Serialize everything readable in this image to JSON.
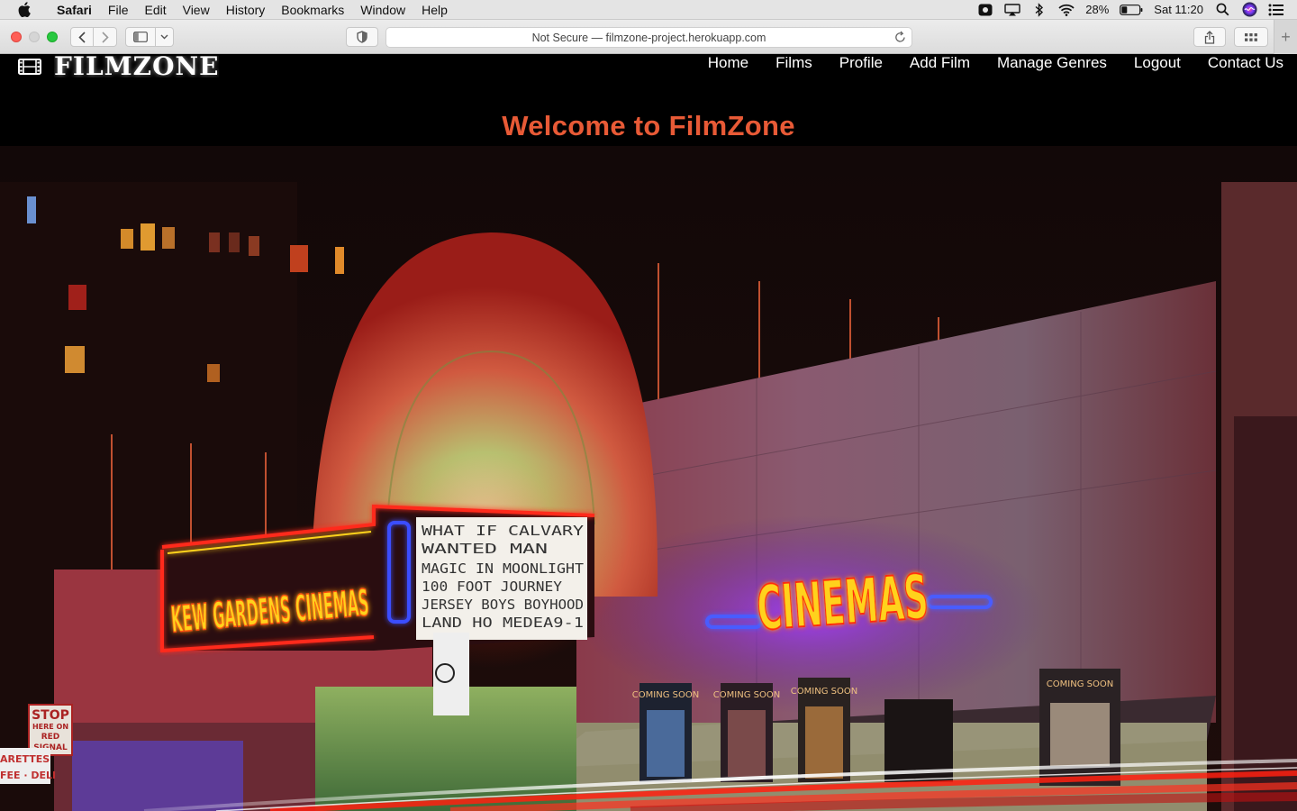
{
  "menubar": {
    "apple_icon": "apple-icon",
    "app_name": "Safari",
    "menus": [
      "File",
      "Edit",
      "View",
      "History",
      "Bookmarks",
      "Window",
      "Help"
    ],
    "battery": "28%",
    "clock": "Sat 11:20"
  },
  "browser": {
    "address": "Not Secure — filmzone-project.herokuapp.com"
  },
  "site": {
    "logo_text": "FILMZONE",
    "nav": [
      "Home",
      "Films",
      "Profile",
      "Add Film",
      "Manage Genres",
      "Logout",
      "Contact Us"
    ],
    "welcome": "Welcome to FilmZone",
    "hero_signs": {
      "marquee_left": "KEW GARDENS CINEMAS",
      "marquee_right": "CINEMAS",
      "board_lines": [
        "WHAT IF      CALVARY",
        "WANTED MAN",
        "MAGIC IN MOONLIGHT",
        "100 FOOT JOURNEY",
        "JERSEY BOYS  BOYHOOD",
        "LAND HO    MEDEA9-1"
      ],
      "poster_labels": [
        "COMING SOON",
        "COMING SOON",
        "COMING SOON",
        "COMING SOON"
      ],
      "stop_sign": [
        "STOP",
        "HERE ON",
        "RED",
        "SIGNAL"
      ],
      "deli_sign": [
        "ARETTES",
        "FEE · DELI"
      ]
    }
  },
  "colors": {
    "welcome": "#e85a36",
    "neon_red": "#ff2a1a",
    "neon_yellow": "#ffd21a",
    "neon_blue": "#3a4dff"
  }
}
